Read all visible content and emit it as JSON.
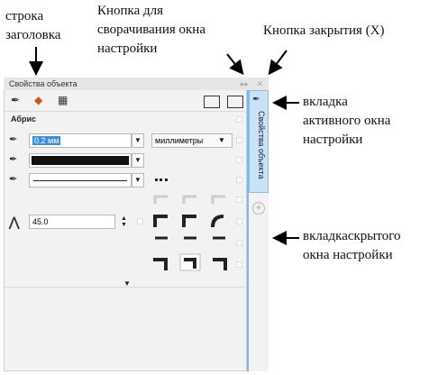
{
  "annotations": {
    "title_bar": "строка\nзаголовка",
    "collapse_button": "Кнопка для\nсворачивания окна\nнастройки",
    "close_button": "Кнопка закрытия (X)",
    "active_tab": "вкладка\nактивного окна\nнастройки",
    "hidden_tab": "вкладкаскрытого\nокна настройки"
  },
  "panel": {
    "title": "Свойства объекта",
    "collapse_icon": "double-chevron-right-icon",
    "close_icon": "close-x-icon",
    "section_title": "Абрис",
    "width_value": "0.2 мм",
    "units_value": "миллиметры",
    "miter_value": "45.0",
    "vertical_tab_label": "Свойства объекта"
  },
  "colors": {
    "accent": "#7fb8e6",
    "active_tab_bg": "#c9e2f7",
    "panel_bg": "#f2f2f2",
    "stroke_color": "#111111"
  }
}
